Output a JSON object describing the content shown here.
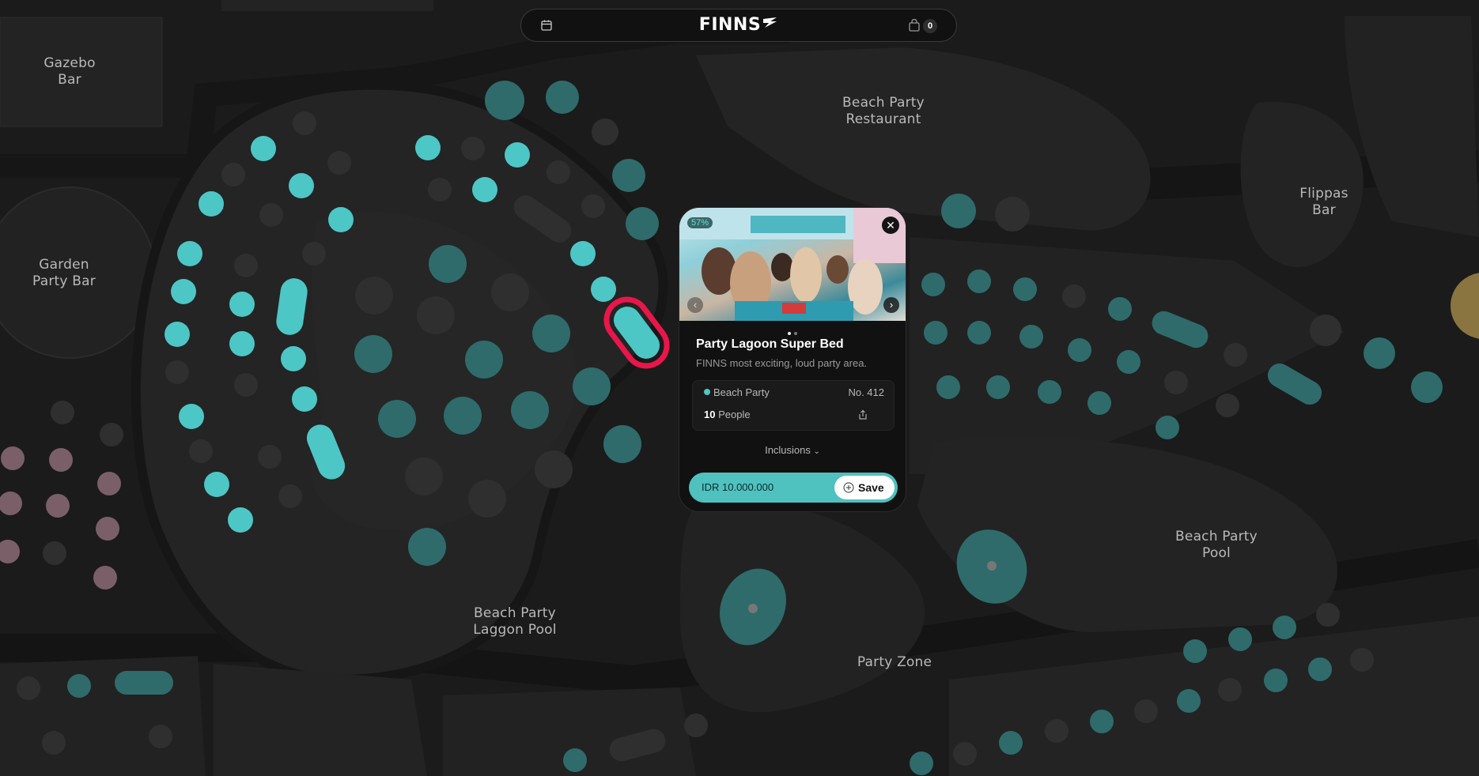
{
  "header": {
    "logo": "FINNS",
    "cart_count": "0",
    "icons": [
      "calendar-icon",
      "shopping-bag-icon"
    ]
  },
  "map": {
    "areas": [
      {
        "name": "gazebo-bar",
        "line1": "Gazebo",
        "line2": "Bar"
      },
      {
        "name": "beach-party-restaurant",
        "line1": "Beach Party",
        "line2": "Restaurant"
      },
      {
        "name": "flippas-bar",
        "line1": "Flippas",
        "line2": "Bar"
      },
      {
        "name": "garden-party-bar",
        "line1": "Garden",
        "line2": "Party Bar"
      },
      {
        "name": "beach-party-laggon-pool",
        "line1": "Beach Party",
        "line2": "Laggon Pool"
      },
      {
        "name": "beach-party-pool",
        "line1": "Beach Party",
        "line2": "Pool"
      },
      {
        "name": "party-zone",
        "line1": "Party Zone",
        "line2": ""
      }
    ],
    "colors": {
      "available": "#4dc6c6",
      "available_dim": "#2d6a6a",
      "unavailable": "#2f2f2f",
      "other_zone": "#7a5f68",
      "selected_ring": "#e8164a"
    }
  },
  "popup": {
    "discount": "57%",
    "title": "Party Lagoon Super Bed",
    "subtitle": "FINNS most exciting, loud party area.",
    "category": "Beach Party",
    "number": "No. 412",
    "people_count": "10",
    "people_label": "People",
    "inclusions_label": "Inclusions",
    "price": "IDR 10.000.000",
    "save_label": "Save",
    "image_pages": 2,
    "active_page": 1
  }
}
